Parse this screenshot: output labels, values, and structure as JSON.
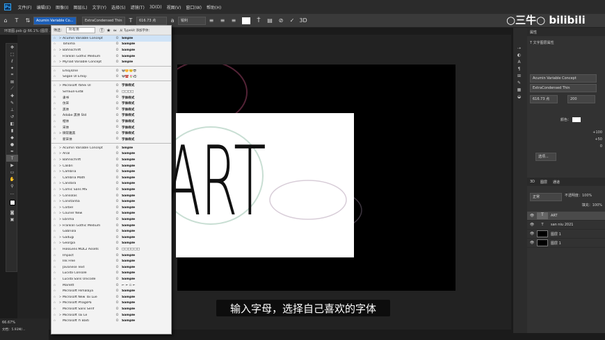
{
  "menubar": {
    "items": [
      "文件(F)",
      "编辑(E)",
      "图像(I)",
      "图层(L)",
      "文字(Y)",
      "选择(S)",
      "滤镜(T)",
      "3D(D)",
      "视图(V)",
      "窗口(W)",
      "帮助(H)"
    ]
  },
  "options": {
    "font_family": "Acumin Variable Co...",
    "font_style": "ExtraCondensed Thin",
    "font_size": "616.73 点",
    "antialias": "锐利"
  },
  "doc_tab": "环境图.psb @ 66.1% (图层 ...",
  "font_dropdown": {
    "filter_label": "筛选：",
    "filter_value": "所有类",
    "typekit_text": "从 Typekit 添加字体：",
    "group1": [
      {
        "name": "Acumin Variable Concept",
        "sample": "Smple",
        "arrow": ">"
      },
      {
        "name": "Tahoma",
        "sample": "Sample",
        "arrow": ""
      },
      {
        "name": "Bahnschrift",
        "sample": "Sample",
        "arrow": ">"
      },
      {
        "name": "Franklin Gothic Medium",
        "sample": "Sample",
        "arrow": ""
      },
      {
        "name": "Myriad Variable Concept",
        "sample": "Smple",
        "arrow": ">"
      }
    ],
    "group2": [
      {
        "name": "EmojiOne",
        "sample": "😀🌼☺️😎",
        "arrow": ""
      },
      {
        "name": "Segoe UI Emoji",
        "sample": "😀☎️🌷⚽",
        "arrow": ""
      }
    ],
    "group3": [
      {
        "name": "Microsoft Yahei UI",
        "sample": "字体样式",
        "arrow": ">"
      },
      {
        "name": "SimSun-ExtB",
        "sample": "□□□□",
        "arrow": ""
      },
      {
        "name": "隶书",
        "sample": "字体样式",
        "arrow": ""
      },
      {
        "name": "仿宋",
        "sample": "字体样式",
        "arrow": ""
      },
      {
        "name": "黑体",
        "sample": "字体样式",
        "arrow": ""
      },
      {
        "name": "Adobe 黑体 Std",
        "sample": "字体样式",
        "arrow": ""
      },
      {
        "name": "楷体",
        "sample": "字体样式",
        "arrow": ""
      },
      {
        "name": "宋体",
        "sample": "字体样式",
        "arrow": ""
      },
      {
        "name": "微软雅黑",
        "sample": "字体样式",
        "arrow": ">"
      },
      {
        "name": "新宋体",
        "sample": "字体样式",
        "arrow": ""
      }
    ],
    "group4": [
      {
        "name": "Acumin Variable Concept",
        "sample": "Smple",
        "arrow": ">"
      },
      {
        "name": "Arial",
        "sample": "Sample",
        "arrow": ">"
      },
      {
        "name": "Bahnschrift",
        "sample": "Sample",
        "arrow": ">"
      },
      {
        "name": "Calibri",
        "sample": "Sample",
        "arrow": ">"
      },
      {
        "name": "Cambria",
        "sample": "Sample",
        "arrow": ">"
      },
      {
        "name": "Cambria Math",
        "sample": "Sample",
        "arrow": ""
      },
      {
        "name": "Candara",
        "sample": "Sample",
        "arrow": ">"
      },
      {
        "name": "Comic Sans MS",
        "sample": "Sample",
        "arrow": ">"
      },
      {
        "name": "Consolas",
        "sample": "Sample",
        "arrow": ">"
      },
      {
        "name": "Constantia",
        "sample": "Sample",
        "arrow": ">"
      },
      {
        "name": "Corbel",
        "sample": "Sample",
        "arrow": ">"
      },
      {
        "name": "Courier New",
        "sample": "Sample",
        "arrow": ">"
      },
      {
        "name": "Ebrima",
        "sample": "Sample",
        "arrow": ">"
      },
      {
        "name": "Franklin Gothic Medium",
        "sample": "Sample",
        "arrow": ">"
      },
      {
        "name": "Gabriola",
        "sample": "Sample",
        "arrow": ""
      },
      {
        "name": "Gadugi",
        "sample": "Sample",
        "arrow": ">"
      },
      {
        "name": "Georgia",
        "sample": "Sample",
        "arrow": ">"
      },
      {
        "name": "HoloLens MDL2 Assets",
        "sample": "□□□□□□",
        "arrow": ""
      },
      {
        "name": "Impact",
        "sample": "Sample",
        "arrow": ""
      },
      {
        "name": "Ink Free",
        "sample": "Sample",
        "arrow": ""
      },
      {
        "name": "Javanese Text",
        "sample": "Sample",
        "arrow": ""
      },
      {
        "name": "Lucida Console",
        "sample": "Sample",
        "arrow": ""
      },
      {
        "name": "Lucida Sans Unicode",
        "sample": "Sample",
        "arrow": ""
      },
      {
        "name": "Marlett",
        "sample": "⌐ ⌐ ▫ ⌐",
        "arrow": ""
      },
      {
        "name": "Microsoft Himalaya",
        "sample": "Sample",
        "arrow": ""
      },
      {
        "name": "Microsoft New Tai Lue",
        "sample": "Sample",
        "arrow": ">"
      },
      {
        "name": "Microsoft PhagsPa",
        "sample": "Sample",
        "arrow": ">"
      },
      {
        "name": "Microsoft Sans Serif",
        "sample": "Sample",
        "arrow": ""
      },
      {
        "name": "Microsoft Tai Le",
        "sample": "Sample",
        "arrow": ">"
      },
      {
        "name": "Microsoft Yi Baiti",
        "sample": "Sample",
        "arrow": ""
      }
    ]
  },
  "canvas": {
    "text": "ART"
  },
  "subtitle": "输入字母，选择自己喜欢的字体",
  "watermark": "○三牛○ bilibili",
  "properties": {
    "title": "属性",
    "subtitle": "文字图层属性",
    "font": "Acumin Variable Concept",
    "style": "ExtraCondensed Thin",
    "size": "616.73 点",
    "leading": "200",
    "color_label": "颜色：",
    "r1": "+100",
    "r2": "+50",
    "r3": "0",
    "more": "选项..."
  },
  "layers": {
    "tabs": [
      "3D",
      "图层",
      "通道"
    ],
    "mode": "正常",
    "opacity": "不透明度：100%",
    "fill": "填充：100%",
    "items": [
      {
        "name": "ART"
      },
      {
        "name": "san niu 2021"
      },
      {
        "name": "图层 1"
      },
      {
        "name": "图层 1"
      }
    ]
  },
  "status": {
    "zoom": "66.67%",
    "doc": "文档：5.93M/..."
  }
}
